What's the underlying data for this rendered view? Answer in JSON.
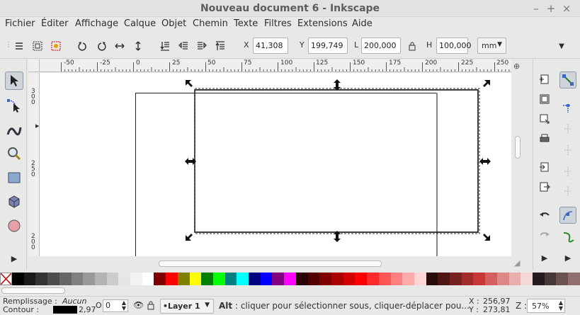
{
  "window": {
    "title": "Nouveau document 6 - Inkscape",
    "minimize": "–",
    "maximize": "+",
    "close": "×"
  },
  "menu": [
    "Fichier",
    "Éditer",
    "Affichage",
    "Calque",
    "Objet",
    "Chemin",
    "Texte",
    "Filtres",
    "Extensions",
    "Aide"
  ],
  "toolbar": {
    "x_label": "X",
    "x_value": "41,308",
    "y_label": "Y",
    "y_value": "199,749",
    "w_label": "L",
    "w_value": "200,000",
    "h_label": "H",
    "h_value": "100,000",
    "unit": "mm"
  },
  "ruler": {
    "h_ticks": [
      "-50",
      "-25",
      "0",
      "25",
      "50",
      "75",
      "100",
      "125",
      "150",
      "175",
      "200",
      "225",
      "250"
    ],
    "v_ticks": [
      [
        "3",
        "0",
        "0"
      ],
      [
        "2",
        "5",
        "0"
      ],
      [
        "2",
        "0",
        "0"
      ]
    ]
  },
  "palette": [
    "#000000",
    "#1a1a1a",
    "#333333",
    "#4d4d4d",
    "#666666",
    "#808080",
    "#999999",
    "#b3b3b3",
    "#cccccc",
    "#e6e6e6",
    "#f2f2f2",
    "#ffffff",
    "#800000",
    "#ff0000",
    "#808000",
    "#ffff00",
    "#008000",
    "#00ff00",
    "#008080",
    "#00ffff",
    "#000080",
    "#0000ff",
    "#800080",
    "#ff00ff",
    "#2b0000",
    "#550000",
    "#800000",
    "#aa0000",
    "#d40000",
    "#ff0000",
    "#ff2a2a",
    "#ff5555",
    "#ff8080",
    "#ffaaaa",
    "#ffd5d5",
    "#280b0b",
    "#501616",
    "#782121",
    "#a02c2c",
    "#c83737",
    "#d35f5f",
    "#de8787",
    "#e9afaf",
    "#f4d7d7",
    "#241c1c",
    "#483737",
    "#6c5353",
    "#916f6f"
  ],
  "status": {
    "fill_label": "Remplissage :",
    "fill_value": "Aucun",
    "stroke_label": "Contour :",
    "stroke_width": "2,97",
    "opacity_label": "O",
    "opacity_value": "0",
    "layer": "•Layer 1",
    "message_bold": "Alt",
    "message": " : cliquer pour sélectionner sous, cliquer-déplacer pou...",
    "x_label": "X :",
    "x_value": "256,97",
    "y_label": "Y :",
    "y_value": "273,81",
    "zoom_label": "Z :",
    "zoom_value": "57%"
  }
}
